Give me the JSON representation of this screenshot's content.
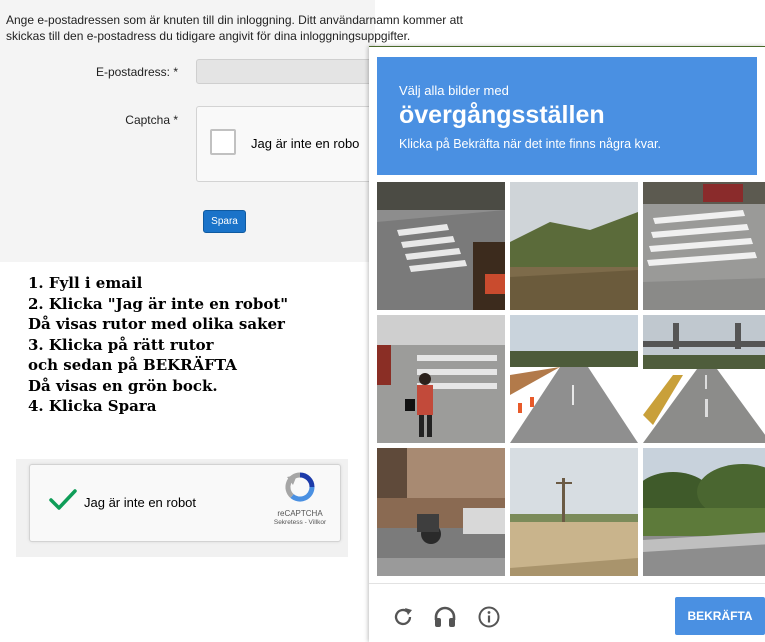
{
  "form": {
    "intro_line1": "Ange e-postadressen som är knuten till din inloggning. Ditt användarnamn kommer att",
    "intro_line2": "skickas till den e-postadress du tidigare angivit för dina inloggningsuppgifter.",
    "email_label": "E-postadress: *",
    "email_value": "",
    "captcha_label": "Captcha *",
    "captcha_text": "Jag är inte en robo",
    "save_label": "Spara"
  },
  "instructions": [
    "1. Fyll i email",
    "2. Klicka \"Jag är inte en robot\"",
    "Då visas rutor med olika saker",
    "3. Klicka på rätt rutor",
    "och sedan på BEKRÄFTA",
    "Då visas en grön bock.",
    "4. Klicka Spara"
  ],
  "recaptcha_demo": {
    "label": "Jag är inte en robot",
    "brand": "reCAPTCHA",
    "links": "Sekretess - Villkor",
    "checked": true
  },
  "challenge": {
    "line1": "Välj alla bilder med",
    "line2": "övergångsställen",
    "line3": "Klicka på Bekräfta när det inte finns några kvar.",
    "verify_label": "BEKRÄFTA",
    "footer_icons": [
      "reload-icon",
      "audio-icon",
      "info-icon"
    ]
  },
  "colors": {
    "header_blue": "#4a90e2",
    "button_blue": "#1a73c9",
    "check_green": "#0f9d58"
  }
}
